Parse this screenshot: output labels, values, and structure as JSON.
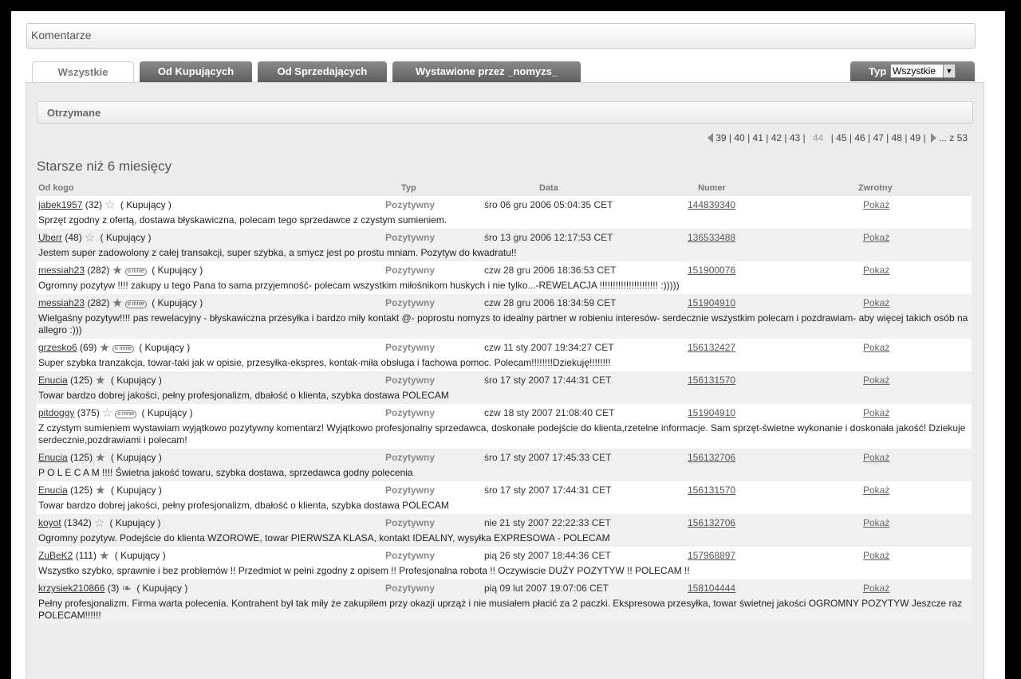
{
  "title": "Komentarze",
  "tabs": [
    "Wszystkie",
    "Od Kupujących",
    "Od Sprzedających",
    "Wystawione przez _nomyzs_"
  ],
  "type_filter": {
    "label": "Typ",
    "value": "Wszystkie"
  },
  "section": "Otrzymane",
  "pagination": {
    "pages_before": [
      "39",
      "40",
      "41",
      "42",
      "43"
    ],
    "current": "44",
    "pages_after": [
      "45",
      "46",
      "47",
      "48",
      "49"
    ],
    "ellipsis": "...",
    "of": "z",
    "total": "53"
  },
  "heading": "Starsze niż 6 miesięcy",
  "columns": {
    "from": "Od kogo",
    "type": "Typ",
    "date": "Data",
    "number": "Numer",
    "returned": "Zwrotny"
  },
  "rows": [
    {
      "user": "jabek1957",
      "score": "(32)",
      "star": "outline",
      "omnie": false,
      "role": "( Kupujący )",
      "type": "Pozytywny",
      "date": "śro 06 gru 2006 05:04:35 CET",
      "number": "144839340",
      "show": "Pokaż",
      "comment": "Sprzęt zgodny z ofertą, dostawa błyskawiczna, polecam tego sprzedawce z czystym sumieniem."
    },
    {
      "user": "Uberr",
      "score": "(48)",
      "star": "outline",
      "omnie": false,
      "role": "( Kupujący )",
      "type": "Pozytywny",
      "date": "śro 13 gru 2006 12:17:53 CET",
      "number": "136533488",
      "show": "Pokaż",
      "comment": "Jestem super zadowolony z całej transakcji, super szybka, a smycz jest po prostu mniam. Pozytyw do kwadratu!!"
    },
    {
      "user": "messiah23",
      "score": "(282)",
      "star": "filled",
      "omnie": true,
      "role": "( Kupujący )",
      "type": "Pozytywny",
      "date": "czw 28 gru 2006 18:36:53 CET",
      "number": "151900076",
      "show": "Pokaż",
      "comment": "Ogromny pozytyw !!!! zakupy u tego Pana to sama przyjemność- polecam wszystkim miłośnikom huskych i nie tylko...-REWELACJA !!!!!!!!!!!!!!!!!!!!!! :)))))"
    },
    {
      "user": "messiah23",
      "score": "(282)",
      "star": "filled",
      "omnie": true,
      "role": "( Kupujący )",
      "type": "Pozytywny",
      "date": "czw 28 gru 2006 18:34:59 CET",
      "number": "151904910",
      "show": "Pokaż",
      "comment": "Wielgaśny pozytyw!!!! pas rewelacyjny - błyskawiczna przesyłka i bardzo miły kontakt @- poprostu nomyzs to idealny partner w robieniu interesów- serdecznie wszystkim polecam i pozdrawiam- aby więcej takich osób na allegro :)))"
    },
    {
      "user": "grzesko6",
      "score": "(69)",
      "star": "filled",
      "omnie": true,
      "role": "( Kupujący )",
      "type": "Pozytywny",
      "date": "czw 11 sty 2007 19:34:27 CET",
      "number": "156132427",
      "show": "Pokaż",
      "comment": "Super szybka tranzakcja, towar-taki jak w opisie, przesyłka-ekspres, kontak-miła obsługa i fachowa pomoc. Polecam!!!!!!!!Dziekuję!!!!!!!!"
    },
    {
      "user": "Enucia",
      "score": "(125)",
      "star": "filled",
      "omnie": false,
      "role": "( Kupujący )",
      "type": "Pozytywny",
      "date": "śro 17 sty 2007 17:44:31 CET",
      "number": "156131570",
      "show": "Pokaż",
      "comment": "Towar bardzo dobrej jakości, pełny profesjonalizm, dbałość o klienta, szybka dostawa POLECAM"
    },
    {
      "user": "pitdoggy",
      "score": "(375)",
      "star": "outline",
      "omnie": true,
      "role": "( Kupujący )",
      "type": "Pozytywny",
      "date": "czw 18 sty 2007 21:08:40 CET",
      "number": "151904910",
      "show": "Pokaż",
      "comment": "Z czystym sumieniem wystawiam wyjątkowo pozytywny komentarz! Wyjątkowo profesjonalny sprzedawca, doskonałe podejście do klienta,rzetelne informacje. Sam sprzęt-świetne wykonanie i doskonała jakość! Dziekuje serdecznie,pozdrawiami i polecam!"
    },
    {
      "user": "Enucia",
      "score": "(125)",
      "star": "filled",
      "omnie": false,
      "role": "( Kupujący )",
      "type": "Pozytywny",
      "date": "śro 17 sty 2007 17:45:33 CET",
      "number": "156132706",
      "show": "Pokaż",
      "comment": "P O L E C A M !!!! Świetna jakość towaru, szybka dostawa, sprzedawca godny polecenia"
    },
    {
      "user": "Enucia",
      "score": "(125)",
      "star": "filled",
      "omnie": false,
      "role": "( Kupujący )",
      "type": "Pozytywny",
      "date": "śro 17 sty 2007 17:44:31 CET",
      "number": "156131570",
      "show": "Pokaż",
      "comment": "Towar bardzo dobrej jakości, pełny profesjonalizm, dbałość o klienta, szybka dostawa POLECAM"
    },
    {
      "user": "koyot",
      "score": "(1342)",
      "star": "outline",
      "omnie": false,
      "role": "( Kupujący )",
      "type": "Pozytywny",
      "date": "nie 21 sty 2007 22:22:33 CET",
      "number": "156132706",
      "show": "Pokaż",
      "comment": "Ogromny pozytyw. Podejście do klienta WZOROWE, towar PIERWSZA KLASA, kontakt IDEALNY, wysyłka EXPRESOWA - POLECAM"
    },
    {
      "user": "ZuBeK2",
      "score": "(111)",
      "star": "filled",
      "omnie": false,
      "role": "( Kupujący )",
      "type": "Pozytywny",
      "date": "pią 26 sty 2007 18:44:36 CET",
      "number": "157968897",
      "show": "Pokaż",
      "comment": "Wszystko szybko, sprawnie i bez problemów !! Przedmiot w pełni zgodny z opisem !! Profesjonalna robota !! Oczywiscie DUŻY POZYTYW !! POLECAM !!"
    },
    {
      "user": "krzysiek210866",
      "score": "(3)",
      "star": "leaf",
      "omnie": false,
      "role": "( Kupujący )",
      "type": "Pozytywny",
      "date": "pią 09 lut 2007 19:07:06 CET",
      "number": "158104444",
      "show": "Pokaż",
      "comment": "Pełny profesjonalizm. Firma warta polecenia. Kontrahent był tak miły że zakupiłem przy okazji uprząż i nie musiałem płacić za 2 paczki. Ekspresowa przesyłka, towar świetnej jakości OGROMNY POZYTYW Jeszcze raz POLECAM!!!!!!"
    }
  ]
}
